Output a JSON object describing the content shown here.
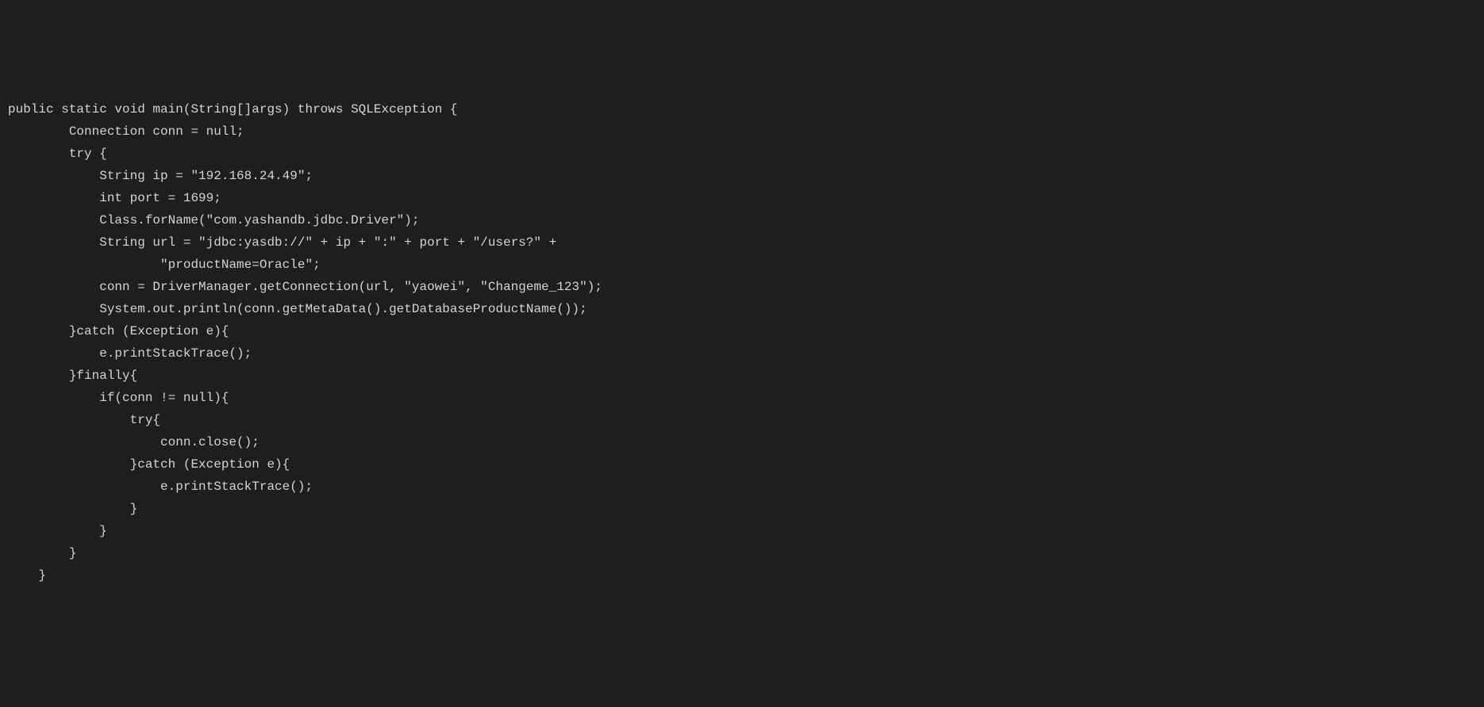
{
  "code": {
    "lines": [
      "public static void main(String[]args) throws SQLException {",
      "        Connection conn = null;",
      "        try {",
      "            String ip = \"192.168.24.49\";",
      "            int port = 1699;",
      "            Class.forName(\"com.yashandb.jdbc.Driver\");",
      "            String url = \"jdbc:yasdb://\" + ip + \":\" + port + \"/users?\" +",
      "                    \"productName=Oracle\";",
      "            conn = DriverManager.getConnection(url, \"yaowei\", \"Changeme_123\");",
      "            System.out.println(conn.getMetaData().getDatabaseProductName());",
      "        }catch (Exception e){",
      "            e.printStackTrace();",
      "        }finally{",
      "            if(conn != null){",
      "                try{",
      "                    conn.close();",
      "                }catch (Exception e){",
      "                    e.printStackTrace();",
      "                }",
      "            }",
      "        }",
      "    }"
    ]
  }
}
